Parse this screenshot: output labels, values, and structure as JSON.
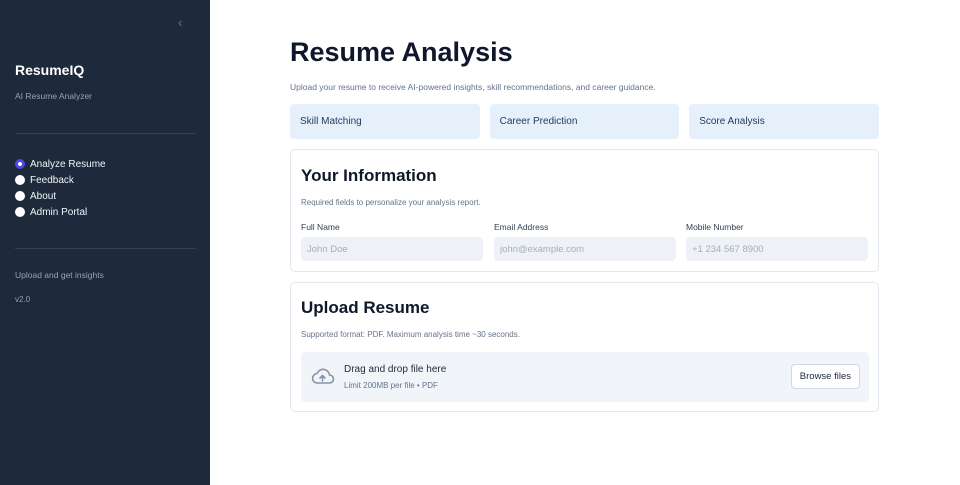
{
  "sidebar": {
    "collapse_icon": "chevron-left-icon",
    "brand": "ResumeIQ",
    "tagline": "AI Resume Analyzer",
    "nav": [
      {
        "label": "Analyze Resume",
        "selected": true
      },
      {
        "label": "Feedback",
        "selected": false
      },
      {
        "label": "About",
        "selected": false
      },
      {
        "label": "Admin Portal",
        "selected": false
      }
    ],
    "footer_text": "Upload and get insights",
    "version": "v2.0"
  },
  "main": {
    "title": "Resume Analysis",
    "subtitle": "Upload your resume to receive AI-powered insights, skill recommendations, and career guidance.",
    "features": [
      "Skill Matching",
      "Career Prediction",
      "Score Analysis"
    ]
  },
  "info_card": {
    "title": "Your Information",
    "subtitle": "Required fields to personalize your analysis report.",
    "fields": [
      {
        "label": "Full Name",
        "value": "",
        "placeholder": "John Doe"
      },
      {
        "label": "Email Address",
        "value": "",
        "placeholder": "john@example.com"
      },
      {
        "label": "Mobile Number",
        "value": "",
        "placeholder": "+1 234 567 8900"
      }
    ]
  },
  "upload_card": {
    "title": "Upload Resume",
    "subtitle": "Supported format: PDF. Maximum analysis time ~30 seconds.",
    "dropzone_icon": "cloud-upload-icon",
    "dropzone_title": "Drag and drop file here",
    "dropzone_sub": "Limit 200MB per file • PDF",
    "browse_label": "Browse files"
  },
  "colors": {
    "sidebar_bg": "#1e293b",
    "accent": "#4f46e5",
    "feature_bg": "#e6f0fb"
  }
}
